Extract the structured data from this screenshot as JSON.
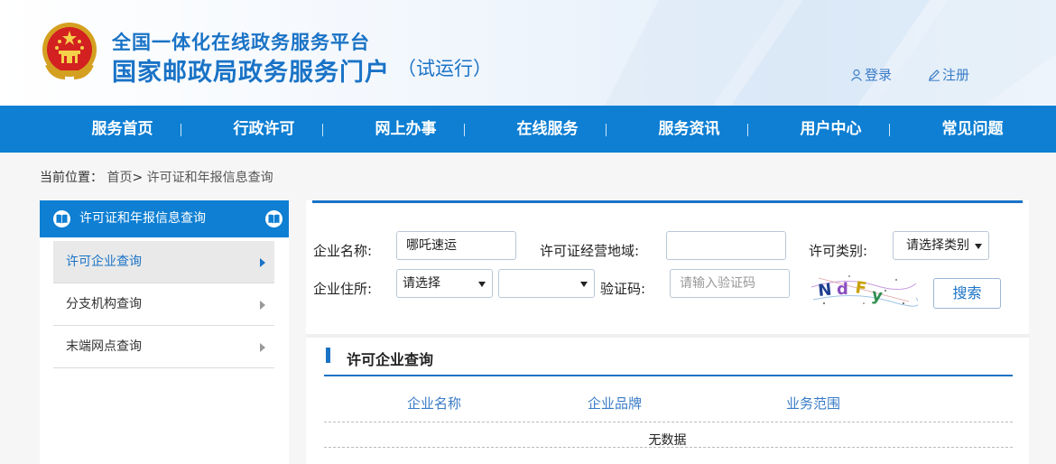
{
  "header": {
    "title_small": "全国一体化在线政务服务平台",
    "title_large": "国家邮政局政务服务门户",
    "trial": "（试运行）",
    "login": "登录",
    "register": "注册"
  },
  "nav": {
    "items": [
      "服务首页",
      "行政许可",
      "网上办事",
      "在线服务",
      "服务资讯",
      "用户中心",
      "常见问题"
    ]
  },
  "breadcrumb": {
    "prefix": "当前位置：",
    "home": "首页",
    "sep": ">",
    "current": "许可证和年报信息查询"
  },
  "sidebar": {
    "title": "许可证和年报信息查询",
    "items": [
      {
        "label": "许可企业查询",
        "active": true
      },
      {
        "label": "分支机构查询",
        "active": false
      },
      {
        "label": "末端网点查询",
        "active": false
      }
    ]
  },
  "search": {
    "company_name_label": "企业名称:",
    "company_name_value": "哪吒速运",
    "region_label": "许可证经营地域:",
    "region_value": "",
    "type_label": "许可类别:",
    "type_value": "请选择类别",
    "address_label": "企业住所:",
    "province_value": "请选择",
    "city_value": "",
    "captcha_label": "验证码:",
    "captcha_placeholder": "请输入验证码",
    "captcha_text": "NdFy",
    "search_button": "搜索"
  },
  "results": {
    "title": "许可企业查询",
    "columns": [
      "企业名称",
      "企业品牌",
      "业务范围"
    ],
    "empty_text": "无数据"
  },
  "colors": {
    "primary": "#0e7fd3",
    "title_blue": "#1a73c6",
    "link_blue": "#3a7cc7"
  }
}
